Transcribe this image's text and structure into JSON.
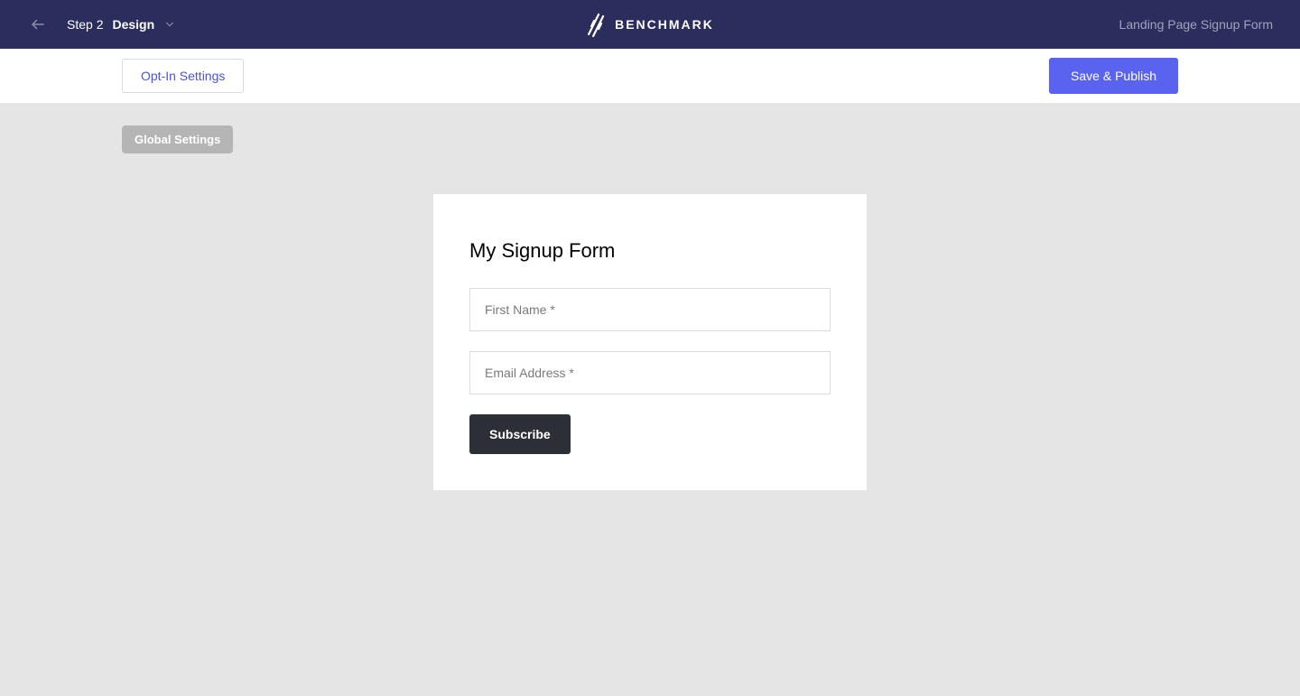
{
  "topbar": {
    "step_prefix": "Step 2",
    "step_title": "Design",
    "brand_name": "BENCHMARK",
    "page_context": "Landing Page Signup Form"
  },
  "subbar": {
    "optin_button": "Opt-In Settings",
    "save_publish_button": "Save & Publish"
  },
  "canvas": {
    "global_settings_label": "Global Settings"
  },
  "form": {
    "title": "My Signup Form",
    "first_name_placeholder": "First Name *",
    "email_placeholder": "Email Address *",
    "subscribe_button": "Subscribe"
  }
}
